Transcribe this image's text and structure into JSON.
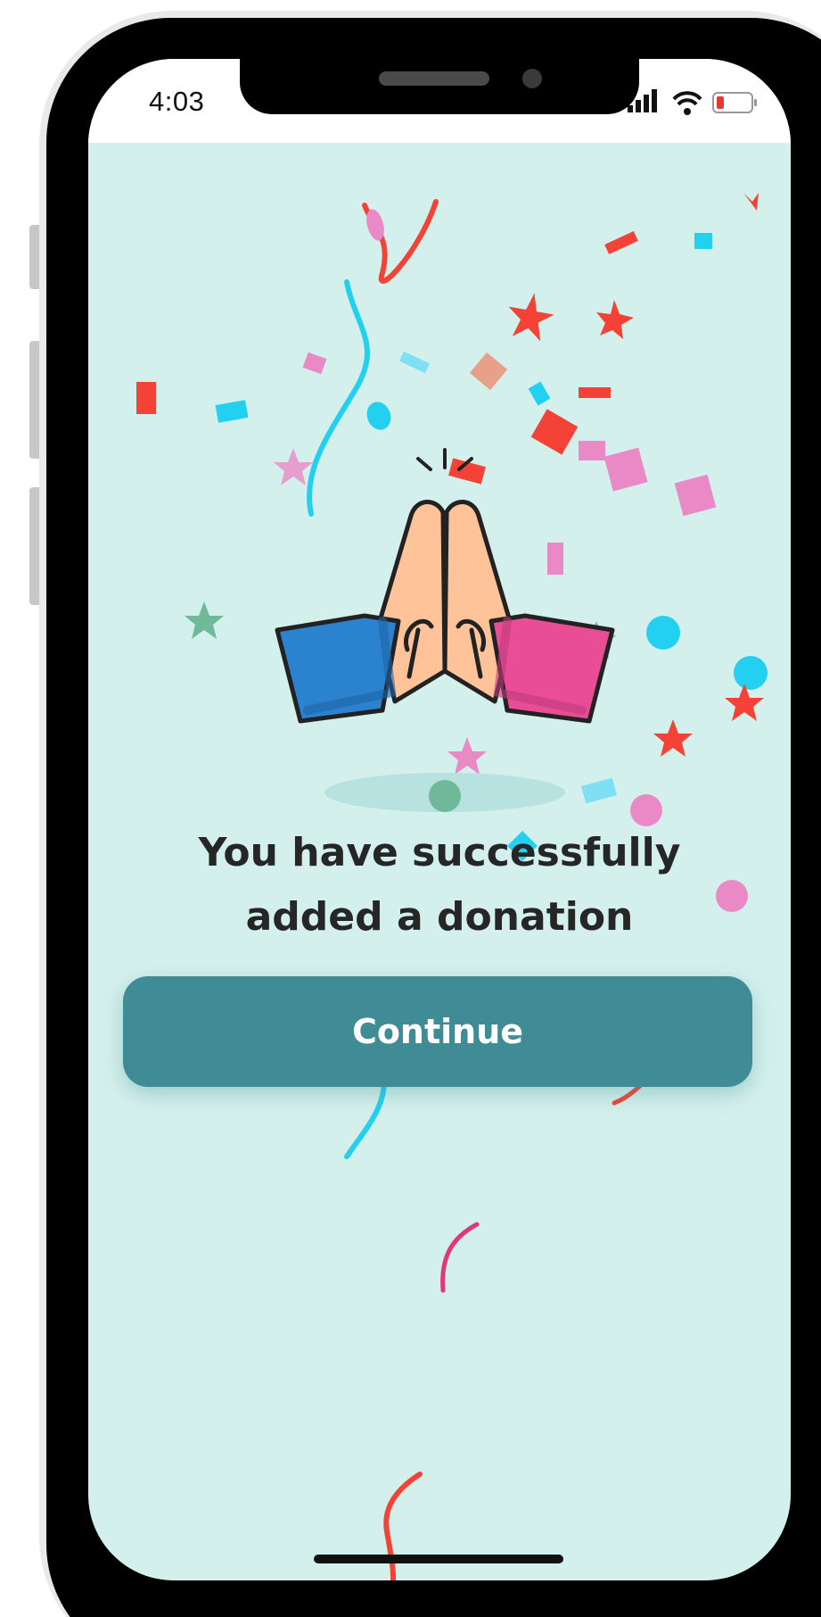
{
  "status_bar": {
    "time": "4:03",
    "icons": [
      "signal-icon",
      "wifi-icon",
      "battery-low-icon"
    ],
    "battery_color": "#e53935"
  },
  "message": {
    "line1": "You have successfully",
    "line2": "added a donation"
  },
  "illustration": {
    "icon": "praying-hands-icon",
    "left_sleeve_color": "#2b82cf",
    "right_sleeve_color": "#e94d96",
    "skin_color": "#ffc39a"
  },
  "actions": {
    "continue_label": "Continue"
  },
  "colors": {
    "background": "#d4f0ec",
    "accent": "#3f8b96",
    "confetti": [
      "#f44336",
      "#24d0f0",
      "#e98ac6",
      "#6fb89a"
    ]
  }
}
